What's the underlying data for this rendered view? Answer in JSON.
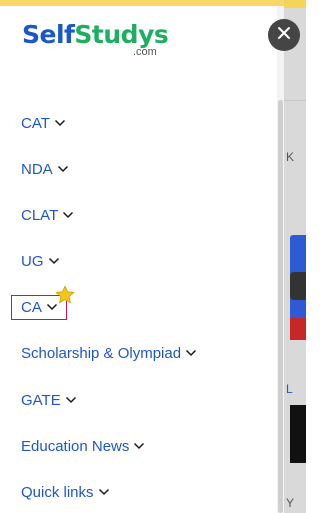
{
  "logo": {
    "part1": "Self",
    "part2": "Studys",
    "suffix": ".com"
  },
  "menu": {
    "items": [
      {
        "label": "CAT"
      },
      {
        "label": "NDA"
      },
      {
        "label": "CLAT"
      },
      {
        "label": "UG"
      },
      {
        "label": "CA"
      },
      {
        "label": "Scholarship & Olympiad"
      },
      {
        "label": "GATE"
      },
      {
        "label": "Education News"
      },
      {
        "label": "Quick links"
      }
    ]
  },
  "backdrop": {
    "chars": [
      "K",
      "L",
      "Y"
    ]
  },
  "colors": {
    "link": "#1f57c8",
    "brand_blue": "#1a57c9",
    "brand_green": "#1fae61",
    "accent_bar": "#f8d768",
    "focus_outline": "#c2185b",
    "close_bg": "#454545"
  },
  "icons": {
    "chevron": "chevron-down-icon",
    "close": "close-icon",
    "star": "star-icon"
  }
}
